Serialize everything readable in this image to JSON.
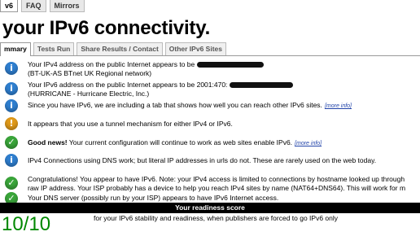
{
  "top_tabs": [
    "v6",
    "FAQ",
    "Mirrors"
  ],
  "title": "your IPv6 connectivity.",
  "sub_tabs": [
    "mmary",
    "Tests Run",
    "Share Results / Contact",
    "Other IPv6 Sites"
  ],
  "colors": {
    "info": "#2f7fd0",
    "warn": "#e09a1a",
    "ok": "#3aa63a",
    "score": "#008800"
  },
  "rows": [
    {
      "icon": "info-icon",
      "lines": [
        "Your IPv4 address on the public Internet appears to be",
        "(BT-UK-AS BTnet UK Regional network)"
      ]
    },
    {
      "icon": "info-icon",
      "lines": [
        "Your IPv6 address on the public Internet appears to be 2001:470:",
        "(HURRICANE - Hurricane Electric, Inc.)"
      ]
    },
    {
      "icon": "info-icon",
      "lines": [
        "Since you have IPv6, we are including a tab that shows how well you can reach other IPv6 sites."
      ],
      "more": "[more info]"
    },
    {
      "icon": "warning-icon",
      "lines": [
        "It appears that you use a tunnel mechanism for either IPv4 or IPv6."
      ]
    },
    {
      "icon": "check-icon",
      "strong": "Good news!",
      "lines": [
        " Your current configuration will continue to work as web sites enable IPv6."
      ],
      "more": "[more info]"
    },
    {
      "icon": "info-icon",
      "lines": [
        "IPv4 Connections using DNS work; but literal IP addresses in urls do not. These are rarely used on the web today."
      ]
    },
    {
      "icon": "check-icon",
      "lines": [
        "Congratulations! You appear to have IPv6. Note: your IPv4 access is limited to connections by hostname looked up through",
        "raw IP address. Your ISP probably has a device to help you reach IPv4 sites by name (NAT64+DNS64). This will work for m"
      ]
    },
    {
      "icon": "check-icon",
      "lines": [
        "Your DNS server (possibly run by your ISP) appears to have IPv6 Internet access."
      ]
    }
  ],
  "readiness_label": "Your readiness score",
  "score": "10/10",
  "score_desc": "for your IPv6 stability and readiness, when publishers are forced to go IPv6 only"
}
